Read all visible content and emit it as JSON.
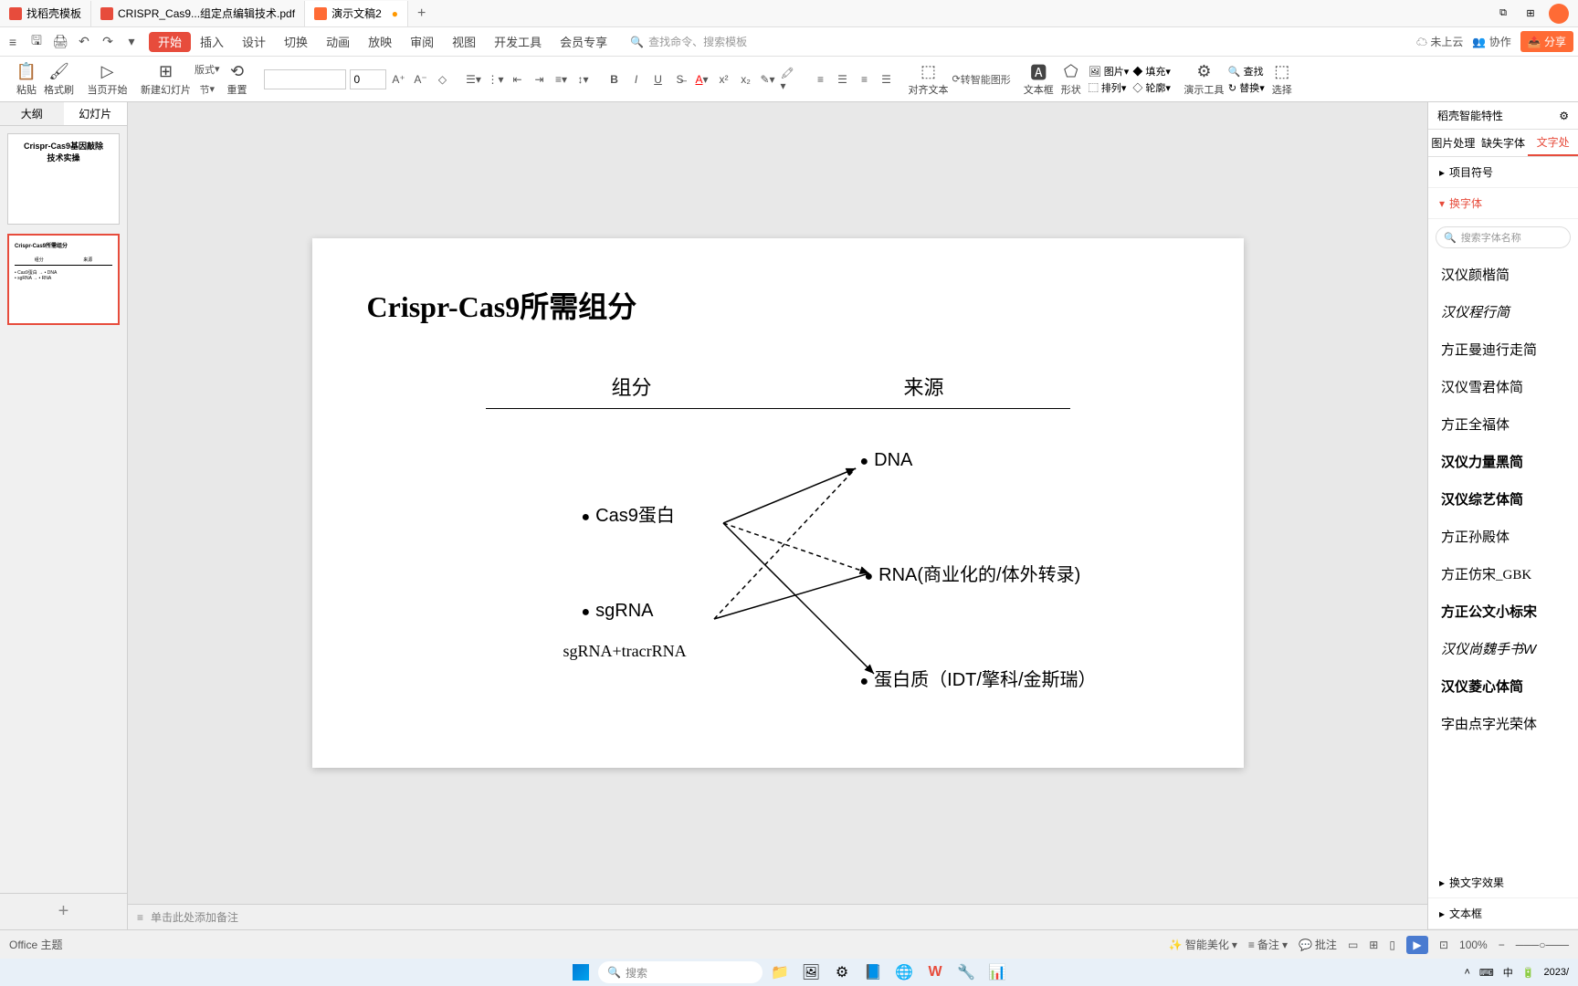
{
  "tabs": {
    "t1": "找稻壳模板",
    "t2": "CRISPR_Cas9...组定点编辑技术.pdf",
    "t3": "演示文稿2"
  },
  "menu": {
    "start": "开始",
    "insert": "插入",
    "design": "设计",
    "trans": "切换",
    "anim": "动画",
    "play": "放映",
    "review": "审阅",
    "view": "视图",
    "dev": "开发工具",
    "member": "会员专享",
    "search_ph": "查找命令、搜索模板"
  },
  "topright": {
    "cloud": "未上云",
    "collab": "协作",
    "share": "分享"
  },
  "toolbar": {
    "paste": "粘贴",
    "format": "格式刷",
    "pagestart": "当页开始",
    "newslide": "新建幻灯片",
    "layout": "版式",
    "section": "节",
    "reset": "重置",
    "fontsize": "0",
    "A_up": "A",
    "A_down": "A",
    "align": "对齐文本",
    "totext": "转智能图形",
    "textbox": "文本框",
    "shape": "形状",
    "pic": "图片",
    "fill": "填充",
    "arrange": "排列",
    "outline": "轮廓",
    "tools": "演示工具",
    "find": "查找",
    "replace": "替换",
    "select": "选择"
  },
  "leftpanel": {
    "outline": "大纲",
    "slides": "幻灯片"
  },
  "thumb1_l1": "Crispr-Cas9基因敲除",
  "thumb1_l2": "技术实操",
  "slide": {
    "title": "Crispr-Cas9所需组分",
    "h1": "组分",
    "h2": "来源",
    "cas9": "Cas9蛋白",
    "sgrna": "sgRNA",
    "sub": "sgRNA+tracrRNA",
    "dna": "DNA",
    "rna": "RNA(商业化的/体外转录)",
    "protein": "蛋白质（IDT/擎科/金斯瑞）"
  },
  "notes": "单击此处添加备注",
  "rightpanel": {
    "header": "稻壳智能特性",
    "tab1": "图片处理",
    "tab2": "缺失字体",
    "tab3": "文字处",
    "sec1": "项目符号",
    "sec2": "换字体",
    "search_ph": "搜索字体名称",
    "sec3": "换文字效果",
    "sec4": "文本框"
  },
  "fonts": {
    "f1": "汉仪颜楷简",
    "f2": "汉仪程行简",
    "f3": "方正曼迪行走简",
    "f4": "汉仪雪君体简",
    "f5": "方正全福体",
    "f6": "汉仪力量黑简",
    "f7": "汉仪综艺体简",
    "f8": "方正孙殿体",
    "f9": "方正仿宋_GBK",
    "f10": "方正公文小标宋",
    "f11": "汉仪尚魏手书W",
    "f12": "汉仪菱心体简",
    "f13": "字由点字光荣体"
  },
  "statusbar": {
    "theme": "Office 主题",
    "smart": "智能美化",
    "notes": "备注",
    "comment": "批注",
    "zoom": "100%"
  },
  "taskbar": {
    "search": "搜索",
    "date": "2023/"
  }
}
